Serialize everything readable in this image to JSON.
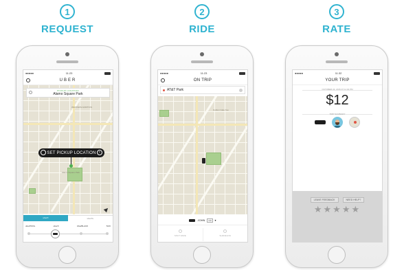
{
  "steps": [
    {
      "number": "1",
      "title": "REQUEST",
      "screen": {
        "status_time": "11:23",
        "nav_title": "UBER",
        "pickup_small": "PICKUP LOCATION",
        "pickup_address": "Alamo Square Park",
        "pickup_button": "SET PICKUP LOCATION",
        "map_label_1": "Alamo Square Park",
        "map_label_2": "WESTERN ADDITION",
        "tab_active": "uberX",
        "tab_inactive": "uberXL",
        "vehicle_options": [
          "uberPOOL",
          "uberX",
          "UberBLACK",
          "TAXI"
        ],
        "selected_option": "uberX"
      }
    },
    {
      "number": "2",
      "title": "RIDE",
      "screen": {
        "status_time": "11:23",
        "nav_title": "ON TRIP",
        "destination": "AT&T Park",
        "map_label_1": "Golden Gate Ave",
        "driver_name": "JOHN",
        "driver_rating": "4.9",
        "action_left": "SPLIT FARE",
        "action_right": "SHARE ETA"
      }
    },
    {
      "number": "3",
      "title": "RATE",
      "screen": {
        "status_time": "11:32",
        "nav_title": "YOUR TRIP",
        "trip_date": "OCTOBER 24, 2015 AT 11:32 PM",
        "fare": "$12",
        "summary_label": "TRIP SUMMARY",
        "leave_feedback": "LEAVE FEEDBACK",
        "need_help": "NEED HELP?",
        "rating_stars": 0,
        "max_stars": 5,
        "stars_glyphs": "★★★★★"
      }
    }
  ],
  "colors": {
    "accent": "#2fb3d0",
    "map_base": "#e6e2d4",
    "park": "#a9cf8f",
    "segment_active": "#2fa8c4"
  }
}
